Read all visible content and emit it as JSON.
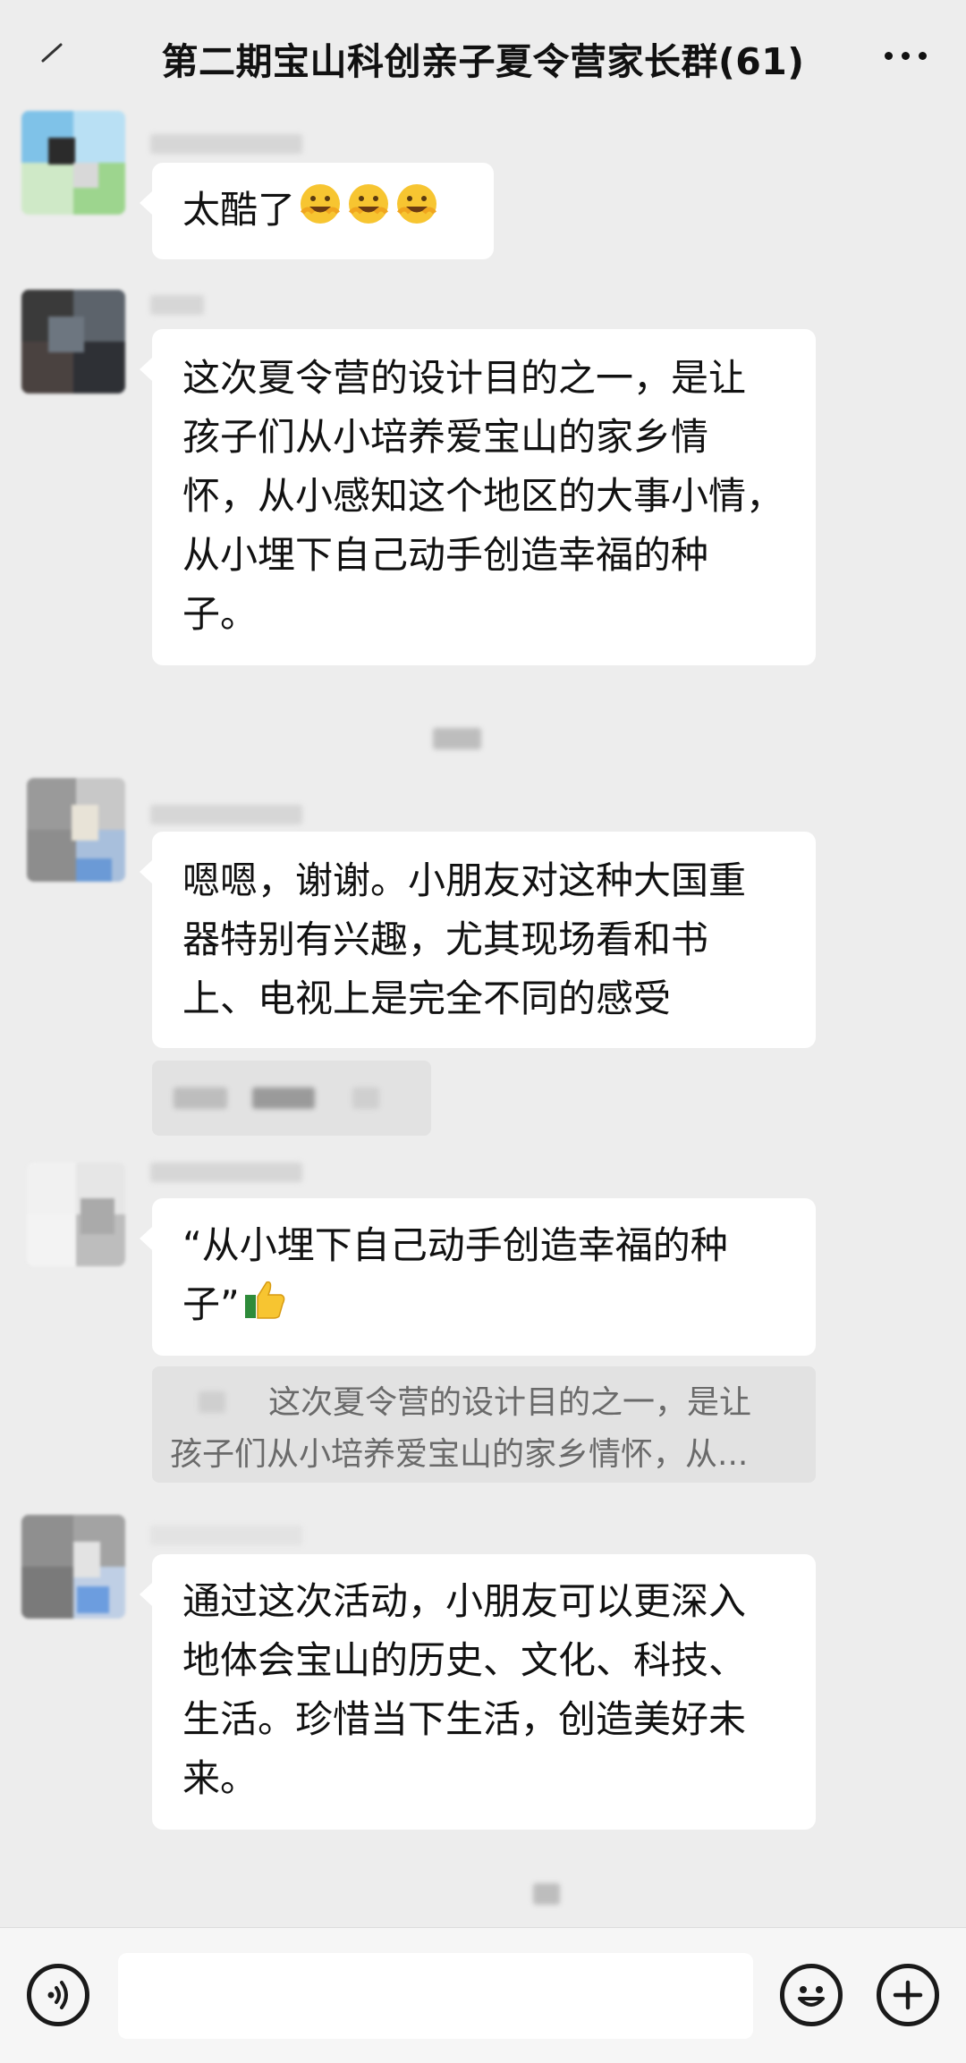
{
  "header": {
    "title": "第二期宝山科创亲子夏令营家长群(61)"
  },
  "messages": [
    {
      "id": "m1",
      "lines": [
        "太酷了"
      ],
      "emoji": [
        "grinning-face-icon",
        "grinning-face-icon",
        "grinning-face-icon"
      ]
    },
    {
      "id": "m2",
      "lines": [
        "这次夏令营的设计目的之一，是让",
        "孩子们从小培养爱宝山的家乡情",
        "怀，从小感知这个地区的大事小情，",
        "从小埋下自己动手创造幸福的种",
        "子。"
      ]
    },
    {
      "id": "m3",
      "lines": [
        "嗯嗯，谢谢。小朋友对这种大国重",
        "器特别有兴趣，尤其现场看和书",
        "上、电视上是完全不同的感受"
      ]
    },
    {
      "id": "m4",
      "lines": [
        "“从小埋下自己动手创造幸福的种",
        "子”"
      ],
      "emoji": [
        "thumbs-up-icon"
      ]
    },
    {
      "id": "m4-quote",
      "lines": [
        "这次夏令营的设计目的之一，是让",
        "孩子们从小培养爱宝山的家乡情怀，从..."
      ]
    },
    {
      "id": "m5",
      "lines": [
        "通过这次活动，小朋友可以更深入",
        "地体会宝山的历史、文化、科技、",
        "生活。珍惜当下生活，创造美好未",
        "来。"
      ]
    }
  ],
  "input_bar": {
    "left_icon": "voice-icon",
    "right_icons": [
      "emoji-icon",
      "plus-icon"
    ]
  },
  "colors": {
    "background": "#ededed",
    "bubble": "#ffffff",
    "quote": "#e2e2e2"
  }
}
